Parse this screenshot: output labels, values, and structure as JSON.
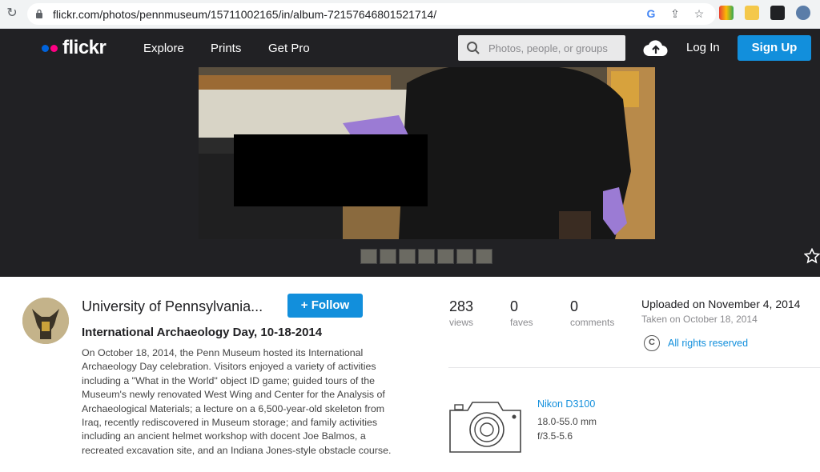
{
  "browser": {
    "url": "flickr.com/photos/pennmuseum/15711002165/in/album-72157646801521714/"
  },
  "header": {
    "logo": "flickr",
    "nav": [
      "Explore",
      "Prints",
      "Get Pro"
    ],
    "search_placeholder": "Photos, people, or groups",
    "login": "Log In",
    "signup": "Sign Up"
  },
  "owner": {
    "name": "University of Pennsylvania...",
    "follow": "+ Follow"
  },
  "photo": {
    "title": "International Archaeology Day, 10-18-2014",
    "description": "On October 18, 2014, the Penn Museum hosted its International Archaeology Day celebration. Visitors enjoyed a variety of activities including a \"What in the World\" object ID game; guided tours of the Museum's newly renovated West Wing and Center for the Analysis of Archaeological Materials; a lecture on a 6,500-year-old skeleton from Iraq, recently rediscovered in Museum storage; and family activities including an ancient helmet workshop with docent Joe Balmos, a recreated excavation site, and an Indiana Jones-style obstacle course."
  },
  "stats": [
    {
      "value": "283",
      "label": "views"
    },
    {
      "value": "0",
      "label": "faves"
    },
    {
      "value": "0",
      "label": "comments"
    }
  ],
  "meta": {
    "uploaded": "Uploaded on November 4, 2014",
    "taken": "Taken on October 18, 2014",
    "rights_symbol": "C",
    "rights": "All rights reserved"
  },
  "camera": {
    "model": "Nikon D3100",
    "lens": "18.0-55.0 mm",
    "aperture": "f/3.5-5.6"
  },
  "colors": {
    "flickr_blue": "#128fdc",
    "flickr_pink": "#ff0084",
    "bar_dark": "#212124"
  }
}
